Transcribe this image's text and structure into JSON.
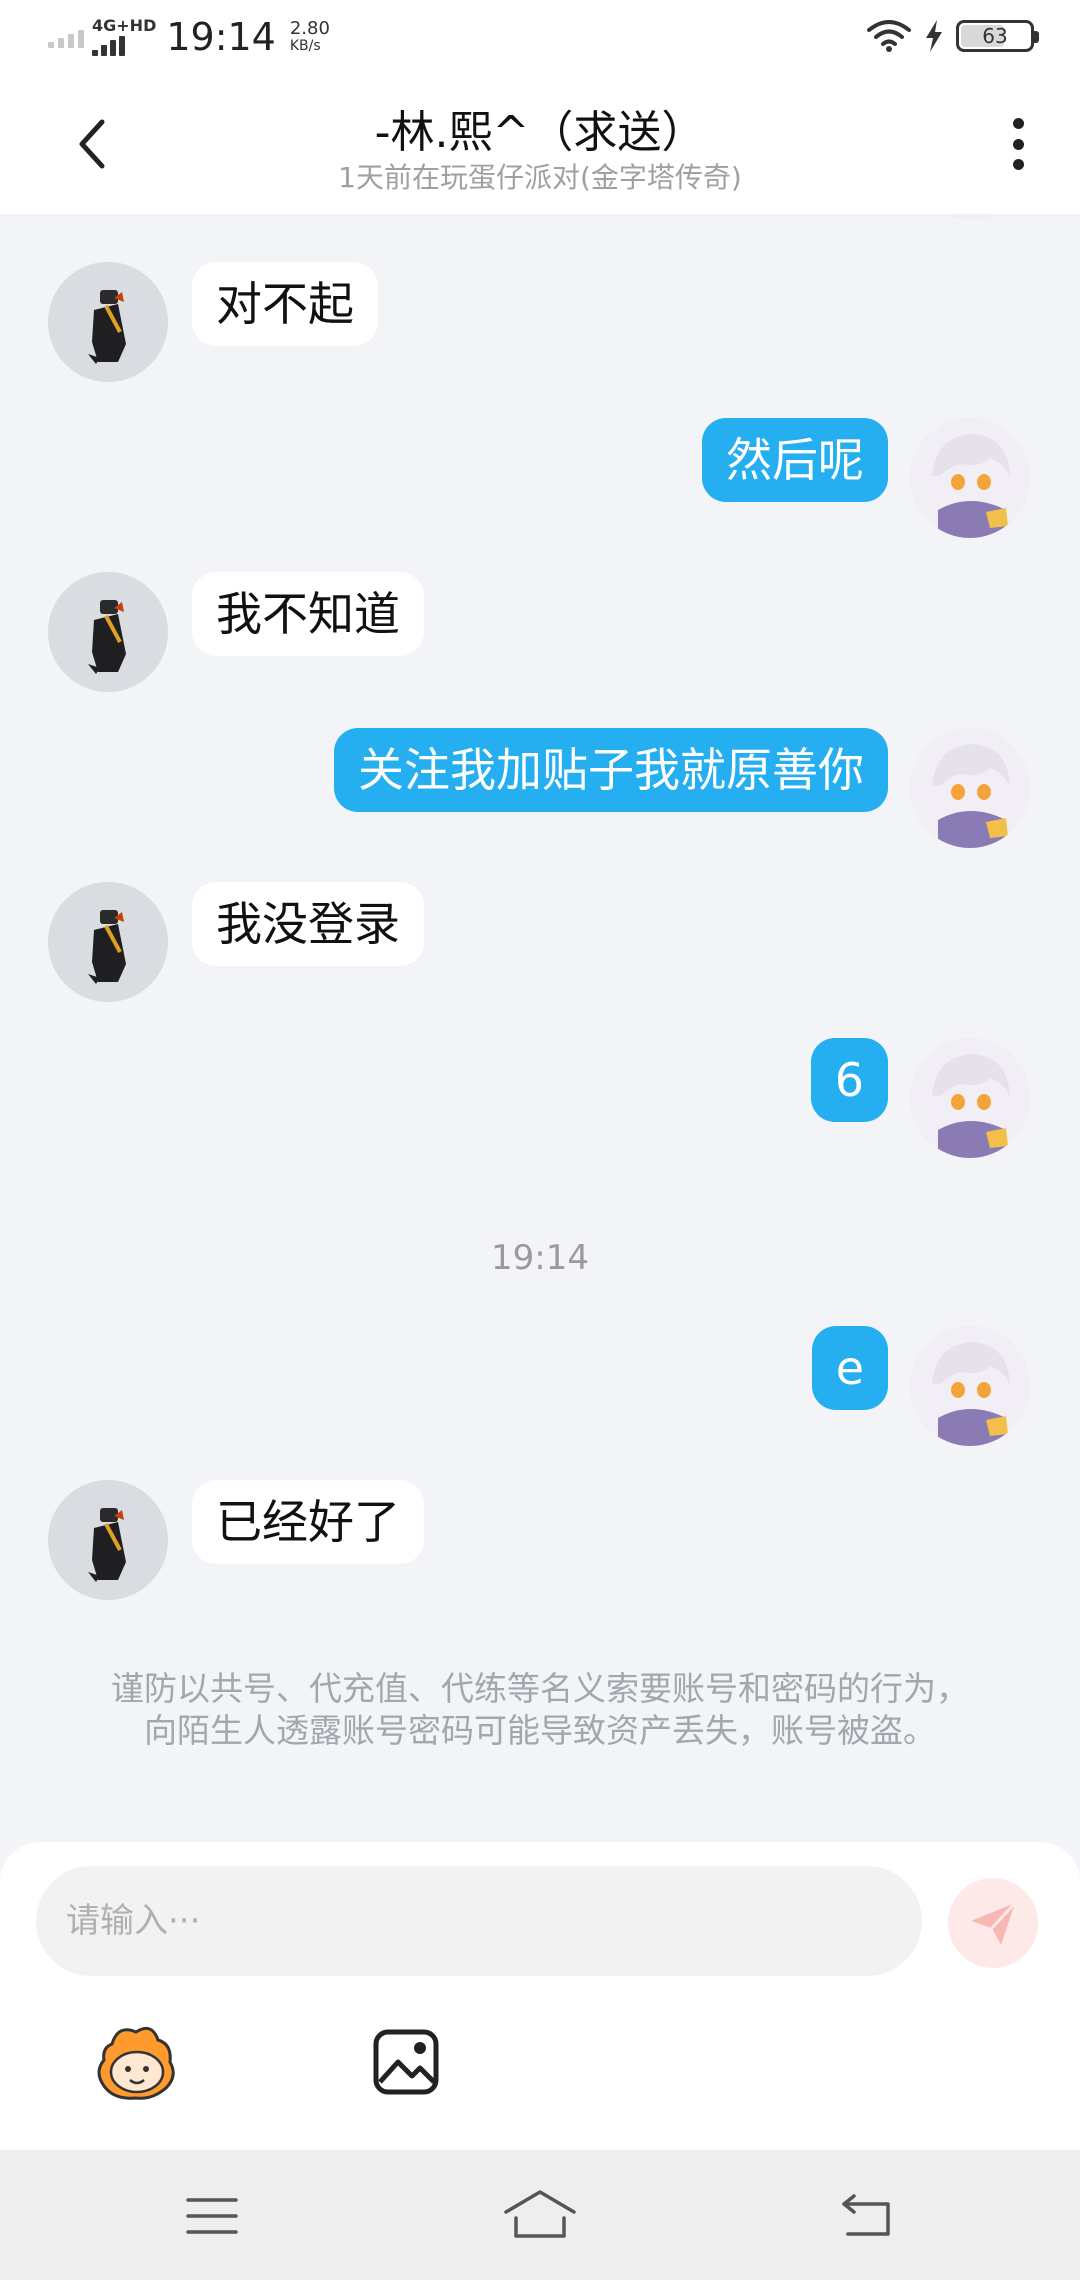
{
  "status_bar": {
    "network": "4G+HD",
    "time": "19:14",
    "speed_value": "2.80",
    "speed_unit": "KB/s",
    "battery": "63"
  },
  "header": {
    "title": "-林.熙^（求送）",
    "subtitle": "1天前在玩蛋仔派对(金字塔传奇)"
  },
  "messages": [
    {
      "side": "in",
      "text": "对不起"
    },
    {
      "side": "out",
      "text": "然后呢"
    },
    {
      "side": "in",
      "text": "我不知道"
    },
    {
      "side": "out",
      "text": "关注我加贴子我就原善你"
    },
    {
      "side": "in",
      "text": "我没登录"
    },
    {
      "side": "out",
      "text": "6"
    },
    {
      "side": "out",
      "text": "e"
    },
    {
      "side": "in",
      "text": "已经好了"
    }
  ],
  "timestamp": "19:14",
  "notice": "谨防以共号、代充值、代练等名义索要账号和密码的行为，向陌生人透露账号密码可能导致资产丢失，账号被盗。",
  "input": {
    "placeholder": "请输入···"
  },
  "colors": {
    "outgoing_bubble": "#25aef0",
    "incoming_bubble": "#ffffff",
    "background": "#f2f4f7",
    "send_button": "#fde9e8"
  },
  "icons": [
    "back-arrow-icon",
    "more-options-icon",
    "send-icon",
    "emoji-mascot-icon",
    "image-icon",
    "nav-menu-icon",
    "nav-home-icon",
    "nav-back-icon"
  ]
}
